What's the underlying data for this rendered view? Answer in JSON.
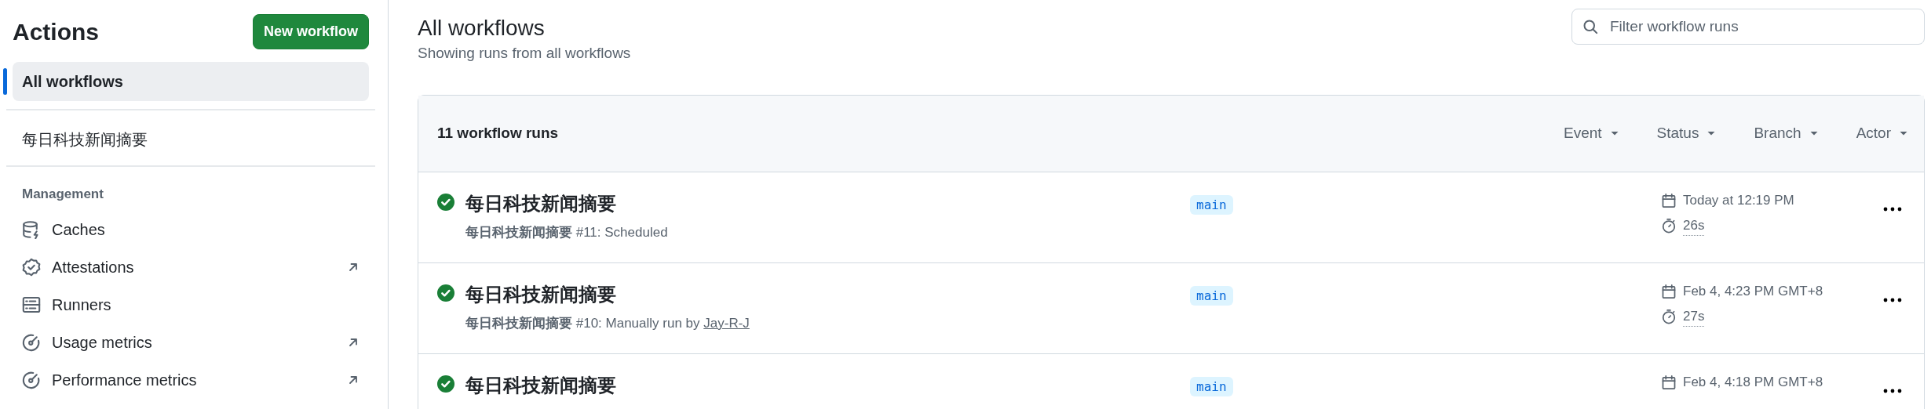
{
  "sidebar": {
    "title": "Actions",
    "new_button": "New workflow",
    "workflows": [
      {
        "label": "All workflows",
        "selected": true
      },
      {
        "label": "每日科技新闻摘要",
        "selected": false
      }
    ],
    "section_heading": "Management",
    "management": [
      {
        "label": "Caches",
        "external": false
      },
      {
        "label": "Attestations",
        "external": true
      },
      {
        "label": "Runners",
        "external": false
      },
      {
        "label": "Usage metrics",
        "external": true
      },
      {
        "label": "Performance metrics",
        "external": true
      }
    ]
  },
  "main": {
    "title": "All workflows",
    "subtitle": "Showing runs from all workflows",
    "search": {
      "placeholder": "Filter workflow runs"
    },
    "runs_count": "11 workflow runs",
    "filters": [
      "Event",
      "Status",
      "Branch",
      "Actor"
    ],
    "runs": [
      {
        "passed": true,
        "title": "每日科技新闻摘要",
        "subtitle": "**每日科技新闻摘要** #11: Scheduled",
        "branch": "main",
        "date": "Today at 12:19 PM",
        "duration": "26s"
      },
      {
        "passed": true,
        "title": "每日科技新闻摘要",
        "subtitle": "**每日科技新闻摘要** #10: Manually run by",
        "actor": "Jay-R-J",
        "branch": "main",
        "date": "Feb 4, 4:23 PM GMT+8",
        "duration": "27s"
      },
      {
        "passed": true,
        "title": "每日科技新闻摘要",
        "branch": "main",
        "date": "Feb 4, 4:18 PM GMT+8"
      }
    ]
  }
}
